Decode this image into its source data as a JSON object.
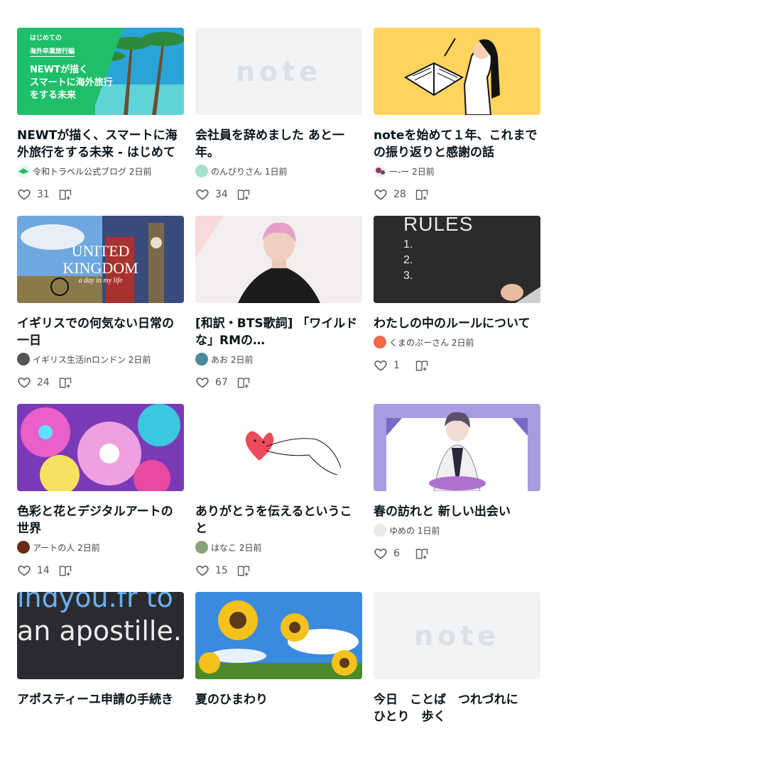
{
  "cards": [
    {
      "title": "NEWTが描く、スマートに海外旅行をする未来 - はじめての海外卒業旅行編",
      "author": "令和トラベル公式ブログ",
      "time": "2日前",
      "likes": "31",
      "thumb_text": [
        "はじめての",
        "海外卒業旅行編",
        "NEWTが描く",
        "スマートに海外旅行",
        "をする未来"
      ]
    },
    {
      "title": "会社員を辞めました あと一年。",
      "author": "のんびりさん",
      "time": "1日前",
      "likes": "34",
      "thumb_text": [
        "note"
      ]
    },
    {
      "title": "noteを始めて１年、これまでの振り返りと感謝の話",
      "author": "ー-ー",
      "time": "2日前",
      "likes": "28",
      "thumb_text": []
    },
    {
      "title": "イギリスでの何気ない日常の一日",
      "author": "イギリス生活inロンドン",
      "time": "2日前",
      "likes": "24",
      "thumb_text": [
        "UNITED",
        "KINGDOM",
        "a day in my life"
      ]
    },
    {
      "title": "[和訳・BTS歌詞] 「ワイルドな」RMの…",
      "author": "あお",
      "time": "2日前",
      "likes": "67",
      "thumb_text": []
    },
    {
      "title": "わたしの中のルールについて",
      "author": "くまのぷーさん",
      "time": "2日前",
      "likes": "1",
      "thumb_text": [
        "RULES",
        "1.",
        "2.",
        "3."
      ]
    },
    {
      "title": "色彩と花とデジタルアートの世界",
      "author": "アートの人",
      "time": "2日前",
      "likes": "14",
      "thumb_text": []
    },
    {
      "title": "ありがとうを伝えるということ",
      "author": "はなこ",
      "time": "2日前",
      "likes": "15",
      "thumb_text": []
    },
    {
      "title": "春の訪れと 新しい出会い",
      "author": "ゆめの",
      "time": "1日前",
      "likes": "6",
      "thumb_text": []
    },
    {
      "title": "アポスティーユ申請の手続き",
      "author": "",
      "time": "",
      "likes": "",
      "thumb_text": [
        "indyou.fr to",
        "an apostille."
      ]
    },
    {
      "title": "夏のひまわり",
      "author": "",
      "time": "",
      "likes": "",
      "thumb_text": []
    },
    {
      "title": "今日　ことば　つれづれに　ひとり　歩く",
      "author": "",
      "time": "",
      "likes": "",
      "thumb_text": [
        "note"
      ]
    }
  ],
  "colors": {
    "accent": "#08131a",
    "like_icon": "#555555",
    "placeholder_bg": "#f2f3f5"
  },
  "icons": {
    "like": "heart-outline-icon",
    "save": "magazine-add-icon"
  }
}
